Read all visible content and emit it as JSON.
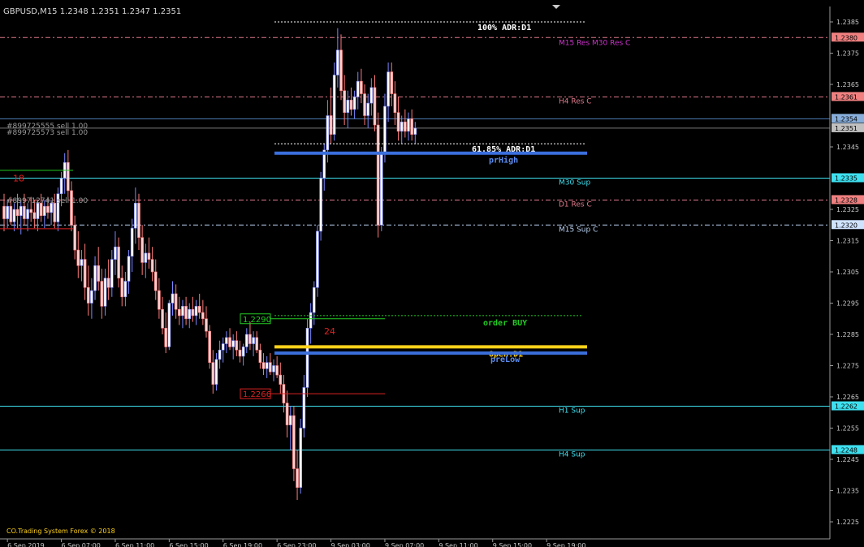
{
  "header": {
    "symbol_info": "GBPUSD,M15  1.2348 1.2351 1.2347 1.2351"
  },
  "footer": {
    "copyright": "CO.Trading System Forex © 2018"
  },
  "orders": [
    {
      "text": "#899725555 sell 1.00",
      "price": 1.2351
    },
    {
      "text": "#899725573 sell 1.00",
      "price": 1.2349
    },
    {
      "text": "#899712741 sell 1.00",
      "price": 1.2326
    }
  ],
  "chart_data": {
    "type": "candlestick",
    "yaxis": {
      "ylim": [
        1.2218,
        1.2388
      ],
      "ticks": [
        1.2385,
        1.2375,
        1.2365,
        1.2345,
        1.2325,
        1.2315,
        1.2305,
        1.2295,
        1.2285,
        1.2275,
        1.2265,
        1.2255,
        1.2245,
        1.2235,
        1.2225
      ]
    },
    "xaxis": {
      "labels": [
        {
          "text": "6 Sep 2019",
          "bar": 1
        },
        {
          "text": "6 Sep 07:00",
          "bar": 17
        },
        {
          "text": "6 Sep 11:00",
          "bar": 33
        },
        {
          "text": "6 Sep 15:00",
          "bar": 49
        },
        {
          "text": "6 Sep 19:00",
          "bar": 65
        },
        {
          "text": "6 Sep 23:00",
          "bar": 81
        },
        {
          "text": "9 Sep 03:00",
          "bar": 97
        },
        {
          "text": "9 Sep 07:00",
          "bar": 113
        },
        {
          "text": "9 Sep 11:00",
          "bar": 129
        },
        {
          "text": "9 Sep 15:00",
          "bar": 145
        },
        {
          "text": "9 Sep 19:00",
          "bar": 161
        }
      ]
    },
    "price_tags": [
      {
        "value": 1.238,
        "label": "1.2380",
        "bg": "#f08080",
        "fg": "#000000"
      },
      {
        "value": 1.2361,
        "label": "1.2361",
        "bg": "#f08080",
        "fg": "#000000"
      },
      {
        "value": 1.2354,
        "label": "1.2354",
        "bg": "#87aedb",
        "fg": "#000000"
      },
      {
        "value": 1.2351,
        "label": "1.2351",
        "bg": "#c0c0c0",
        "fg": "#000000"
      },
      {
        "value": 1.2335,
        "label": "1.2335",
        "bg": "#3ee0f0",
        "fg": "#000000"
      },
      {
        "value": 1.2328,
        "label": "1.2328",
        "bg": "#f08080",
        "fg": "#000000"
      },
      {
        "value": 1.232,
        "label": "1.2320",
        "bg": "#cfe3ff",
        "fg": "#000000"
      },
      {
        "value": 1.2262,
        "label": "1.2262",
        "bg": "#3ee0f0",
        "fg": "#000000"
      },
      {
        "value": 1.2248,
        "label": "1.2248",
        "bg": "#3ee0f0",
        "fg": "#000000"
      }
    ],
    "levels": [
      {
        "name": "M15 Res C",
        "value": 1.238,
        "color": "#e07a8c",
        "dash": "dashdot",
        "label": "M15 Res M30 Res C",
        "label_color": "#cc33cc"
      },
      {
        "name": "H4 Res C",
        "value": 1.2361,
        "color": "#e07a8c",
        "dash": "dashdot",
        "label": "H4 Res C",
        "label_color": "#e07a8c"
      },
      {
        "name": "order-line-1",
        "value": 1.2354,
        "color": "#4f7fb8",
        "dash": "solid",
        "label": "",
        "label_color": "#4f7fb8"
      },
      {
        "name": "M30 Sup",
        "value": 1.2335,
        "color": "#3ee0f0",
        "dash": "solid",
        "label": "M30 Sup",
        "label_color": "#3ee0f0"
      },
      {
        "name": "D1 Res C",
        "value": 1.2328,
        "color": "#e07a8c",
        "dash": "dashdot",
        "label": "D1 Res C",
        "label_color": "#e07a8c"
      },
      {
        "name": "M15 Sup C",
        "value": 1.232,
        "color": "#b8cff0",
        "dash": "dashdot",
        "label": "M15 Sup C",
        "label_color": "#b8cff0"
      },
      {
        "name": "H1 Sup",
        "value": 1.2262,
        "color": "#3ee0f0",
        "dash": "solid",
        "label": "H1 Sup",
        "label_color": "#3ee0f0"
      },
      {
        "name": "H4 Sup",
        "value": 1.2248,
        "color": "#3ee0f0",
        "dash": "solid",
        "label": "H4 Sup",
        "label_color": "#3ee0f0"
      }
    ],
    "adr": [
      {
        "label": "100% ADR:D1",
        "value": 1.2385,
        "color": "#ffffff"
      },
      {
        "label": "61.85% ADR:D1",
        "value": 1.2346,
        "color": "#ffffff"
      }
    ],
    "thick_lines": [
      {
        "label": "prHigh",
        "value": 1.2343,
        "color": "#3a6fdc",
        "label_color": "#5b8cf0"
      },
      {
        "label": "Open:D1",
        "value": 1.2281,
        "color": "#ffd21a",
        "label_color": "#ffd21a"
      },
      {
        "label": "preLow",
        "value": 1.2279,
        "color": "#3a6fdc",
        "label_color": "#5b8cf0"
      }
    ],
    "order_buy": {
      "label": "order BUY",
      "value": 1.2291,
      "color": "#22cc22"
    },
    "boxes": [
      {
        "text": "1.2290",
        "value": 1.229,
        "color": "#22cc22"
      },
      {
        "text": "1.2266",
        "value": 1.2266,
        "color": "#dd2222"
      }
    ],
    "counters": [
      {
        "text": "18",
        "value": 1.2335,
        "color": "#dd2222"
      },
      {
        "text": "24",
        "value": 1.2286,
        "color": "#dd2222"
      }
    ],
    "candles": [
      {
        "o": 1.2326,
        "h": 1.233,
        "l": 1.2318,
        "c": 1.2322
      },
      {
        "o": 1.2322,
        "h": 1.2328,
        "l": 1.2319,
        "c": 1.2326
      },
      {
        "o": 1.2326,
        "h": 1.2329,
        "l": 1.232,
        "c": 1.2321
      },
      {
        "o": 1.2321,
        "h": 1.2327,
        "l": 1.2318,
        "c": 1.2325
      },
      {
        "o": 1.2325,
        "h": 1.233,
        "l": 1.2319,
        "c": 1.2323
      },
      {
        "o": 1.2323,
        "h": 1.2328,
        "l": 1.2317,
        "c": 1.2326
      },
      {
        "o": 1.2326,
        "h": 1.233,
        "l": 1.232,
        "c": 1.2322
      },
      {
        "o": 1.2322,
        "h": 1.2327,
        "l": 1.2318,
        "c": 1.2325
      },
      {
        "o": 1.2325,
        "h": 1.2329,
        "l": 1.2321,
        "c": 1.2324
      },
      {
        "o": 1.2324,
        "h": 1.2328,
        "l": 1.2319,
        "c": 1.2322
      },
      {
        "o": 1.2322,
        "h": 1.2328,
        "l": 1.2318,
        "c": 1.2327
      },
      {
        "o": 1.2327,
        "h": 1.233,
        "l": 1.2321,
        "c": 1.2323
      },
      {
        "o": 1.2323,
        "h": 1.2328,
        "l": 1.2319,
        "c": 1.2326
      },
      {
        "o": 1.2326,
        "h": 1.2329,
        "l": 1.2322,
        "c": 1.2324
      },
      {
        "o": 1.2324,
        "h": 1.2328,
        "l": 1.232,
        "c": 1.2327
      },
      {
        "o": 1.2327,
        "h": 1.233,
        "l": 1.2319,
        "c": 1.2321
      },
      {
        "o": 1.2321,
        "h": 1.2332,
        "l": 1.2318,
        "c": 1.233
      },
      {
        "o": 1.233,
        "h": 1.2337,
        "l": 1.2326,
        "c": 1.2335
      },
      {
        "o": 1.2335,
        "h": 1.2343,
        "l": 1.233,
        "c": 1.234
      },
      {
        "o": 1.234,
        "h": 1.2344,
        "l": 1.2328,
        "c": 1.2331
      },
      {
        "o": 1.2331,
        "h": 1.2334,
        "l": 1.2318,
        "c": 1.232
      },
      {
        "o": 1.232,
        "h": 1.2323,
        "l": 1.2309,
        "c": 1.2312
      },
      {
        "o": 1.2312,
        "h": 1.2318,
        "l": 1.2303,
        "c": 1.2307
      },
      {
        "o": 1.2307,
        "h": 1.2312,
        "l": 1.2302,
        "c": 1.2309
      },
      {
        "o": 1.2309,
        "h": 1.2314,
        "l": 1.2296,
        "c": 1.23
      },
      {
        "o": 1.23,
        "h": 1.2307,
        "l": 1.2291,
        "c": 1.2295
      },
      {
        "o": 1.2295,
        "h": 1.2303,
        "l": 1.229,
        "c": 1.2299
      },
      {
        "o": 1.2299,
        "h": 1.231,
        "l": 1.2296,
        "c": 1.2307
      },
      {
        "o": 1.2307,
        "h": 1.2313,
        "l": 1.2299,
        "c": 1.2302
      },
      {
        "o": 1.2302,
        "h": 1.2306,
        "l": 1.229,
        "c": 1.2294
      },
      {
        "o": 1.2294,
        "h": 1.2306,
        "l": 1.2291,
        "c": 1.2303
      },
      {
        "o": 1.2303,
        "h": 1.2309,
        "l": 1.2296,
        "c": 1.23
      },
      {
        "o": 1.23,
        "h": 1.2312,
        "l": 1.2297,
        "c": 1.2309
      },
      {
        "o": 1.2309,
        "h": 1.2318,
        "l": 1.2304,
        "c": 1.2313
      },
      {
        "o": 1.2313,
        "h": 1.2316,
        "l": 1.23,
        "c": 1.2303
      },
      {
        "o": 1.2303,
        "h": 1.2307,
        "l": 1.2294,
        "c": 1.2297
      },
      {
        "o": 1.2297,
        "h": 1.2305,
        "l": 1.2294,
        "c": 1.2302
      },
      {
        "o": 1.2302,
        "h": 1.2312,
        "l": 1.2298,
        "c": 1.231
      },
      {
        "o": 1.231,
        "h": 1.2322,
        "l": 1.2305,
        "c": 1.2319
      },
      {
        "o": 1.2319,
        "h": 1.2332,
        "l": 1.2314,
        "c": 1.2327
      },
      {
        "o": 1.2327,
        "h": 1.233,
        "l": 1.2312,
        "c": 1.2316
      },
      {
        "o": 1.2316,
        "h": 1.232,
        "l": 1.2304,
        "c": 1.2308
      },
      {
        "o": 1.2308,
        "h": 1.2314,
        "l": 1.2303,
        "c": 1.2311
      },
      {
        "o": 1.2311,
        "h": 1.2316,
        "l": 1.2306,
        "c": 1.2309
      },
      {
        "o": 1.2309,
        "h": 1.2313,
        "l": 1.2302,
        "c": 1.2305
      },
      {
        "o": 1.2305,
        "h": 1.2309,
        "l": 1.2296,
        "c": 1.2299
      },
      {
        "o": 1.2299,
        "h": 1.2303,
        "l": 1.229,
        "c": 1.2293
      },
      {
        "o": 1.2293,
        "h": 1.2297,
        "l": 1.2285,
        "c": 1.2287
      },
      {
        "o": 1.2287,
        "h": 1.2292,
        "l": 1.2279,
        "c": 1.2281
      },
      {
        "o": 1.2281,
        "h": 1.2296,
        "l": 1.228,
        "c": 1.2295
      },
      {
        "o": 1.2295,
        "h": 1.2302,
        "l": 1.2291,
        "c": 1.2298
      },
      {
        "o": 1.2298,
        "h": 1.2301,
        "l": 1.229,
        "c": 1.2293
      },
      {
        "o": 1.2293,
        "h": 1.2297,
        "l": 1.2288,
        "c": 1.2291
      },
      {
        "o": 1.2291,
        "h": 1.2296,
        "l": 1.2287,
        "c": 1.2294
      },
      {
        "o": 1.2294,
        "h": 1.2297,
        "l": 1.2288,
        "c": 1.229
      },
      {
        "o": 1.229,
        "h": 1.2295,
        "l": 1.2287,
        "c": 1.2293
      },
      {
        "o": 1.2293,
        "h": 1.2297,
        "l": 1.2289,
        "c": 1.2291
      },
      {
        "o": 1.2291,
        "h": 1.2296,
        "l": 1.2288,
        "c": 1.2294
      },
      {
        "o": 1.2294,
        "h": 1.2298,
        "l": 1.229,
        "c": 1.2292
      },
      {
        "o": 1.2292,
        "h": 1.2296,
        "l": 1.2288,
        "c": 1.229
      },
      {
        "o": 1.229,
        "h": 1.2294,
        "l": 1.2284,
        "c": 1.2286
      },
      {
        "o": 1.2286,
        "h": 1.2288,
        "l": 1.2274,
        "c": 1.2276
      },
      {
        "o": 1.2276,
        "h": 1.228,
        "l": 1.2266,
        "c": 1.2269
      },
      {
        "o": 1.2269,
        "h": 1.2279,
        "l": 1.2267,
        "c": 1.2277
      },
      {
        "o": 1.2277,
        "h": 1.2283,
        "l": 1.2274,
        "c": 1.228
      },
      {
        "o": 1.228,
        "h": 1.2284,
        "l": 1.2276,
        "c": 1.2282
      },
      {
        "o": 1.2282,
        "h": 1.2286,
        "l": 1.2279,
        "c": 1.2284
      },
      {
        "o": 1.2284,
        "h": 1.2287,
        "l": 1.228,
        "c": 1.2281
      },
      {
        "o": 1.2281,
        "h": 1.2285,
        "l": 1.2277,
        "c": 1.2283
      },
      {
        "o": 1.2283,
        "h": 1.2286,
        "l": 1.2278,
        "c": 1.228
      },
      {
        "o": 1.228,
        "h": 1.2283,
        "l": 1.2276,
        "c": 1.2278
      },
      {
        "o": 1.2278,
        "h": 1.2282,
        "l": 1.2275,
        "c": 1.2281
      },
      {
        "o": 1.2281,
        "h": 1.2287,
        "l": 1.2279,
        "c": 1.2285
      },
      {
        "o": 1.2285,
        "h": 1.2289,
        "l": 1.228,
        "c": 1.2282
      },
      {
        "o": 1.2282,
        "h": 1.2286,
        "l": 1.2278,
        "c": 1.2284
      },
      {
        "o": 1.2284,
        "h": 1.2286,
        "l": 1.2279,
        "c": 1.228
      },
      {
        "o": 1.228,
        "h": 1.2282,
        "l": 1.2274,
        "c": 1.2276
      },
      {
        "o": 1.2276,
        "h": 1.2279,
        "l": 1.2272,
        "c": 1.2274
      },
      {
        "o": 1.2274,
        "h": 1.2278,
        "l": 1.2271,
        "c": 1.2276
      },
      {
        "o": 1.2276,
        "h": 1.2279,
        "l": 1.2272,
        "c": 1.2273
      },
      {
        "o": 1.2273,
        "h": 1.2277,
        "l": 1.227,
        "c": 1.2275
      },
      {
        "o": 1.2275,
        "h": 1.2278,
        "l": 1.2271,
        "c": 1.2272
      },
      {
        "o": 1.2272,
        "h": 1.2276,
        "l": 1.2266,
        "c": 1.2269
      },
      {
        "o": 1.2269,
        "h": 1.2272,
        "l": 1.226,
        "c": 1.2263
      },
      {
        "o": 1.2263,
        "h": 1.2267,
        "l": 1.2252,
        "c": 1.2256
      },
      {
        "o": 1.2256,
        "h": 1.2262,
        "l": 1.2248,
        "c": 1.2259
      },
      {
        "o": 1.2259,
        "h": 1.2262,
        "l": 1.2238,
        "c": 1.2242
      },
      {
        "o": 1.2242,
        "h": 1.2248,
        "l": 1.2232,
        "c": 1.2236
      },
      {
        "o": 1.2236,
        "h": 1.2258,
        "l": 1.2234,
        "c": 1.2255
      },
      {
        "o": 1.2255,
        "h": 1.2272,
        "l": 1.2252,
        "c": 1.2268
      },
      {
        "o": 1.2268,
        "h": 1.229,
        "l": 1.2265,
        "c": 1.2287
      },
      {
        "o": 1.2287,
        "h": 1.2295,
        "l": 1.2282,
        "c": 1.2292
      },
      {
        "o": 1.2292,
        "h": 1.2302,
        "l": 1.2288,
        "c": 1.23
      },
      {
        "o": 1.23,
        "h": 1.232,
        "l": 1.2297,
        "c": 1.2318
      },
      {
        "o": 1.2318,
        "h": 1.2337,
        "l": 1.2315,
        "c": 1.2335
      },
      {
        "o": 1.2335,
        "h": 1.2346,
        "l": 1.2331,
        "c": 1.2344
      },
      {
        "o": 1.2344,
        "h": 1.236,
        "l": 1.234,
        "c": 1.2355
      },
      {
        "o": 1.2355,
        "h": 1.2364,
        "l": 1.2346,
        "c": 1.2349
      },
      {
        "o": 1.2349,
        "h": 1.2372,
        "l": 1.2347,
        "c": 1.2368
      },
      {
        "o": 1.2368,
        "h": 1.2383,
        "l": 1.2364,
        "c": 1.2376
      },
      {
        "o": 1.2376,
        "h": 1.2381,
        "l": 1.236,
        "c": 1.2363
      },
      {
        "o": 1.2363,
        "h": 1.2368,
        "l": 1.2352,
        "c": 1.2356
      },
      {
        "o": 1.2356,
        "h": 1.2363,
        "l": 1.2351,
        "c": 1.236
      },
      {
        "o": 1.236,
        "h": 1.2364,
        "l": 1.2355,
        "c": 1.2357
      },
      {
        "o": 1.2357,
        "h": 1.2363,
        "l": 1.2354,
        "c": 1.2361
      },
      {
        "o": 1.2361,
        "h": 1.2369,
        "l": 1.2357,
        "c": 1.2366
      },
      {
        "o": 1.2366,
        "h": 1.237,
        "l": 1.2359,
        "c": 1.2362
      },
      {
        "o": 1.2362,
        "h": 1.2365,
        "l": 1.2352,
        "c": 1.2355
      },
      {
        "o": 1.2355,
        "h": 1.2362,
        "l": 1.2351,
        "c": 1.2359
      },
      {
        "o": 1.2359,
        "h": 1.2367,
        "l": 1.2355,
        "c": 1.2364
      },
      {
        "o": 1.2364,
        "h": 1.2368,
        "l": 1.235,
        "c": 1.2352
      },
      {
        "o": 1.2352,
        "h": 1.2356,
        "l": 1.2316,
        "c": 1.232
      },
      {
        "o": 1.232,
        "h": 1.2345,
        "l": 1.2318,
        "c": 1.2343
      },
      {
        "o": 1.2343,
        "h": 1.2362,
        "l": 1.234,
        "c": 1.2358
      },
      {
        "o": 1.2358,
        "h": 1.2372,
        "l": 1.2353,
        "c": 1.2369
      },
      {
        "o": 1.2369,
        "h": 1.2372,
        "l": 1.2358,
        "c": 1.2362
      },
      {
        "o": 1.2362,
        "h": 1.2366,
        "l": 1.2352,
        "c": 1.2356
      },
      {
        "o": 1.2356,
        "h": 1.2361,
        "l": 1.2347,
        "c": 1.235
      },
      {
        "o": 1.235,
        "h": 1.2355,
        "l": 1.2346,
        "c": 1.2353
      },
      {
        "o": 1.2353,
        "h": 1.2357,
        "l": 1.2348,
        "c": 1.235
      },
      {
        "o": 1.235,
        "h": 1.2356,
        "l": 1.2347,
        "c": 1.2354
      },
      {
        "o": 1.2354,
        "h": 1.2357,
        "l": 1.2347,
        "c": 1.2349
      },
      {
        "o": 1.2349,
        "h": 1.2353,
        "l": 1.2346,
        "c": 1.2351
      }
    ]
  }
}
